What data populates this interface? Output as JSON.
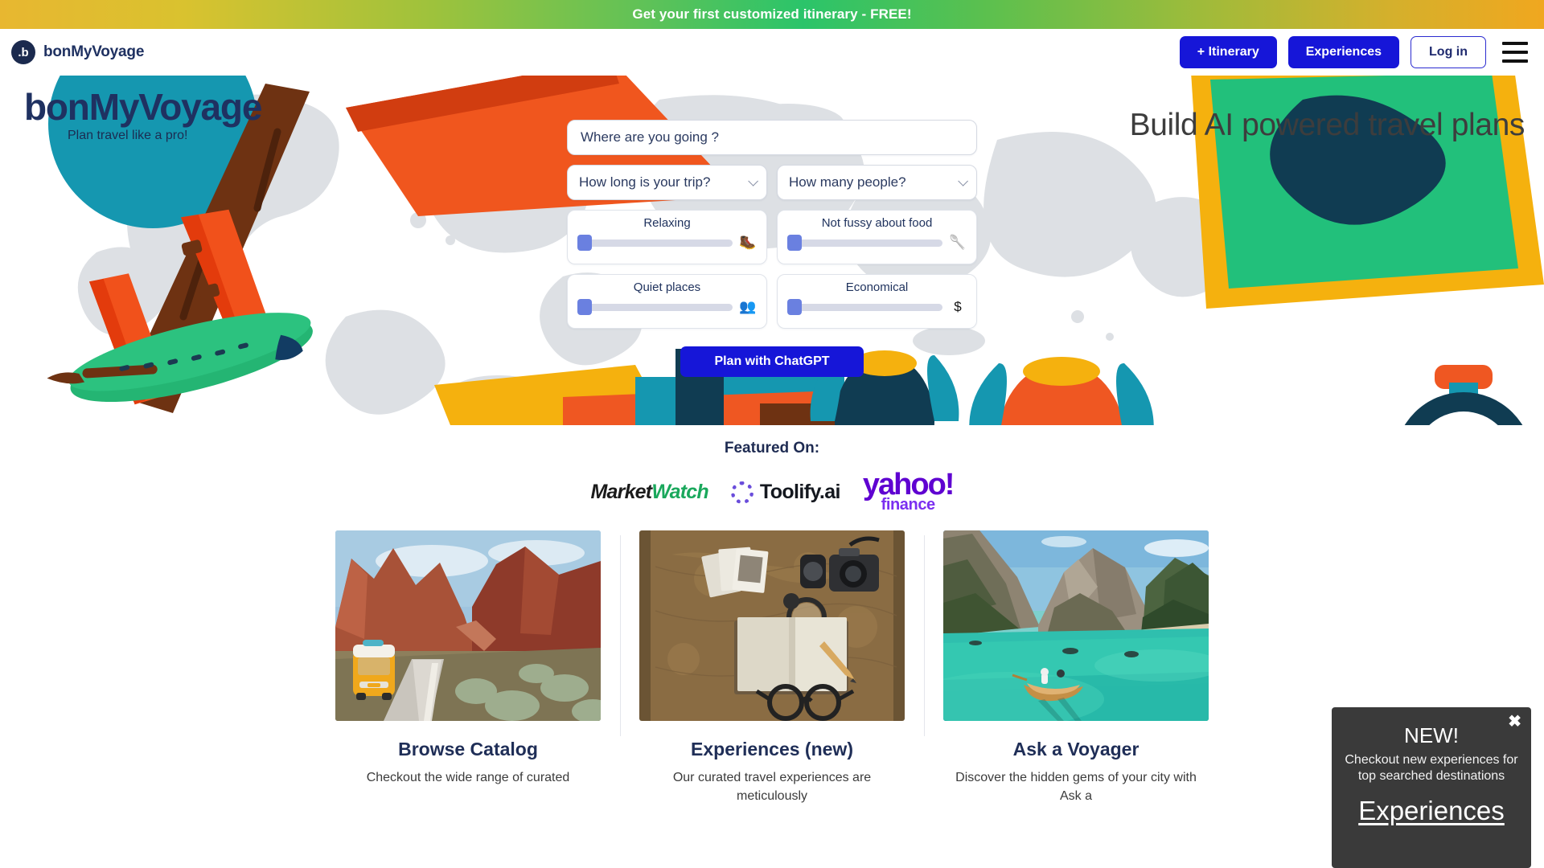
{
  "promo": {
    "text": "Get your first customized itinerary - FREE!"
  },
  "nav": {
    "brand_mark": ".b",
    "brand_name": "bonMyVoyage",
    "itinerary_button": "+ Itinerary",
    "experiences_button": "Experiences",
    "login_button": "Log in",
    "menu_icon": "hamburger-menu-icon"
  },
  "hero": {
    "logo": "bonMyVoyage",
    "tagline": "Plan travel like a pro!",
    "headline": "Build AI powered travel plans"
  },
  "search": {
    "destination_placeholder": "Where are you going ?",
    "duration_selected": "How long is your trip?",
    "people_selected": "How many people?",
    "sliders": [
      {
        "label": "Relaxing",
        "icon": "hiking-icon",
        "glyph": "🥾",
        "value": 0
      },
      {
        "label": "Not fussy about food",
        "icon": "spoon-icon",
        "glyph": "🥄",
        "value": 0
      },
      {
        "label": "Quiet places",
        "icon": "people-icon",
        "glyph": "👥",
        "value": 0
      },
      {
        "label": "Economical",
        "icon": "dollar-icon",
        "glyph": "$",
        "value": 0
      }
    ],
    "submit_button": "Plan with ChatGPT"
  },
  "featured": {
    "title": "Featured On:",
    "logos": [
      {
        "name": "marketwatch-logo",
        "part1": "Market",
        "part2": "Watch"
      },
      {
        "name": "toolify-logo",
        "text": "Toolify.ai"
      },
      {
        "name": "yahoo-finance-logo",
        "line1": "yahoo!",
        "line2": "finance"
      }
    ]
  },
  "cards": [
    {
      "image": "road-trip-van-canyon-photo",
      "title": "Browse Catalog",
      "desc": "Checkout the wide range of curated"
    },
    {
      "image": "travel-journal-map-camera-photo",
      "title": "Experiences (new)",
      "desc": "Our curated travel experiences are meticulously"
    },
    {
      "image": "alpine-lake-boat-photo",
      "title": "Ask a Voyager",
      "desc": "Discover the hidden gems of your city with Ask a"
    }
  ],
  "toast": {
    "close_icon": "close-icon",
    "heading": "NEW!",
    "message": "Checkout new experiences for top searched destinations",
    "link": "Experiences"
  },
  "colors": {
    "brand_navy": "#1f3161",
    "accent_blue": "#1616d8",
    "slider_knob": "#6a80e0",
    "toast_bg": "#3a3a3a"
  }
}
